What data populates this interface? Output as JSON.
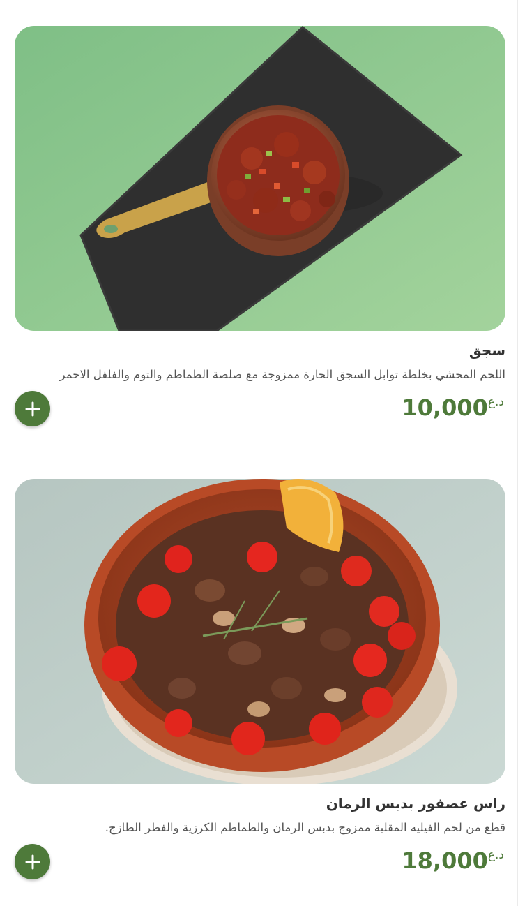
{
  "menu_items": [
    {
      "name": "سجق",
      "description": "اللحم المحشي بخلطة توابل السجق الحارة ممزوجة مع صلصة الطماطم والتوم والفلفل الاحمر",
      "currency": "د.ع",
      "price": "10,000",
      "image": "sujuk-pan-photo",
      "add_icon": "plus-icon"
    },
    {
      "name": "راس عصفور بدبس الرمان",
      "description": "قطع من لحم الفيليه المقلية ممزوج بدبس الرمان والطماطم الكرزية والفطر الطازج.",
      "currency": "د.ع",
      "price": "18,000",
      "image": "ras-asfour-clay-bowl-photo",
      "add_icon": "plus-icon"
    }
  ],
  "colors": {
    "accent": "#4e7a3a",
    "title": "#333333",
    "description": "#555555"
  }
}
